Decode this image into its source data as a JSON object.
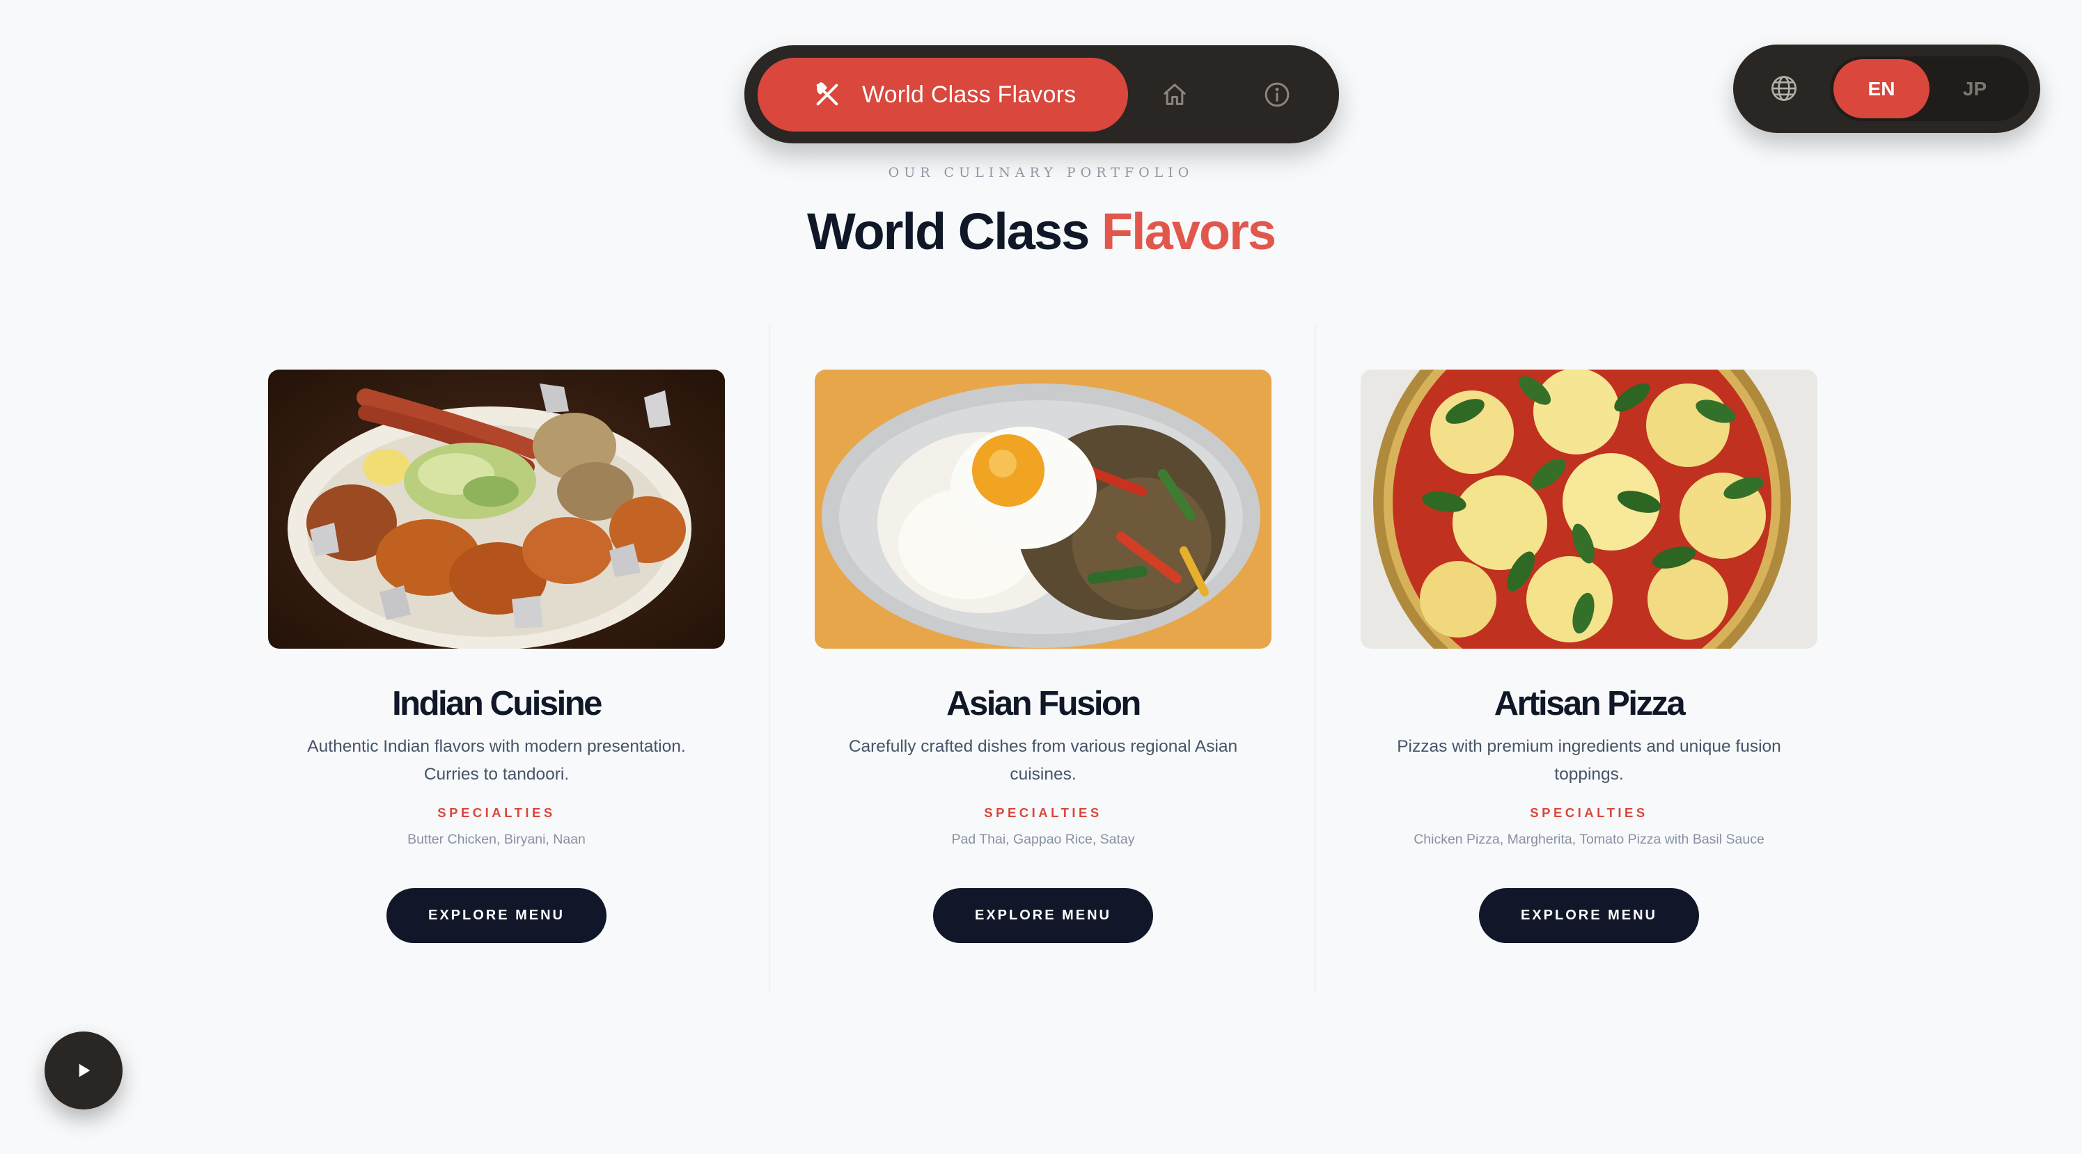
{
  "nav": {
    "brand_label": "World Class Flavors",
    "icons": [
      "utensils-icon",
      "home-icon",
      "info-icon"
    ]
  },
  "language": {
    "icon": "globe-icon",
    "options": [
      "EN",
      "JP"
    ],
    "selected": "EN"
  },
  "heading": {
    "eyebrow": "Our Culinary Portfolio",
    "title_main": "World Class",
    "title_accent": "Flavors"
  },
  "cards": [
    {
      "title": "Indian Cuisine",
      "description": "Authentic Indian flavors with modern presentation. Curries to tandoori.",
      "specialties_label": "SPECIALTIES",
      "specialties": "Butter Chicken, Biryani, Naan",
      "button": "EXPLORE MENU"
    },
    {
      "title": "Asian Fusion",
      "description": "Carefully crafted dishes from various regional Asian cuisines.",
      "specialties_label": "SPECIALTIES",
      "specialties": "Pad Thai, Gappao Rice, Satay",
      "button": "EXPLORE MENU"
    },
    {
      "title": "Artisan Pizza",
      "description": "Pizzas with premium ingredients and unique fusion toppings.",
      "specialties_label": "SPECIALTIES",
      "specialties": "Chicken Pizza, Margherita, Tomato Pizza with Basil Sauce",
      "button": "EXPLORE MENU"
    }
  ],
  "player": {
    "icon": "play-icon"
  },
  "colors": {
    "accent": "#d9473d",
    "dark": "#2a2623",
    "navy": "#111729",
    "background": "#f7f9fb"
  }
}
